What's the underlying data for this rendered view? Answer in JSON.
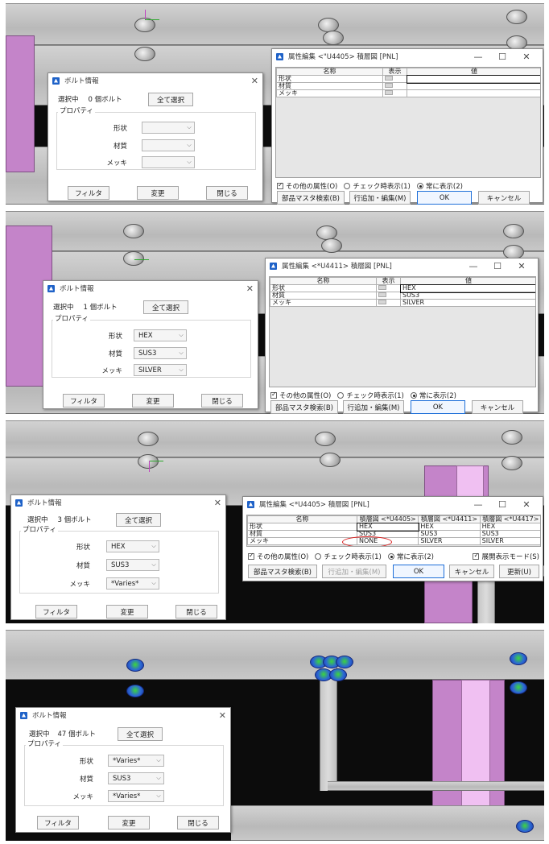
{
  "bolt_dialog": {
    "title": "ボルト情報",
    "select_all": "全て選択",
    "properties_group": "プロパティ",
    "shape_label": "形状",
    "material_label": "材質",
    "plating_label": "メッキ",
    "filter_button": "フィルタ",
    "change_button": "変更",
    "close_button": "閉じる"
  },
  "attr_dialog": {
    "col_name": "名称",
    "col_display": "表示",
    "col_value": "値",
    "rows": [
      "形状",
      "材質",
      "メッキ"
    ],
    "other_attrs": "その他の属性(O)",
    "radio_on_check": "チェック時表示(1)",
    "radio_always": "常に表示(2)",
    "parts_master": "部品マスタ検索(B)",
    "add_edit_rows": "行追加・編集(M)",
    "ok": "OK",
    "cancel": "キャンセル",
    "expand_mode": "展開表示モード(S)",
    "update": "更新(U)"
  },
  "panels": [
    {
      "bolt": {
        "selection": "選択中",
        "count": "0 個ボルト",
        "shape": "",
        "material": "",
        "plating": ""
      },
      "attr": {
        "title": "属性編集 <\"U4405> 積層図 [PNL]",
        "values": [
          "",
          "",
          ""
        ]
      }
    },
    {
      "bolt": {
        "selection": "選択中",
        "count": "1 個ボルト",
        "shape": "HEX",
        "material": "SUS3",
        "plating": "SILVER"
      },
      "attr": {
        "title": "属性編集 <*U4411> 積層図 [PNL]",
        "values": [
          "HEX",
          "SUS3",
          "SILVER"
        ]
      }
    },
    {
      "bolt": {
        "selection": "選択中",
        "count": "3 個ボルト",
        "shape": "HEX",
        "material": "SUS3",
        "plating": "*Varies*"
      },
      "attr": {
        "title": "属性編集 <*U4405> 積層図 [PNL]",
        "columns": [
          "積層図 <*U4405>",
          "積層図 <*U4411>",
          "積層図 <*U4417>"
        ],
        "matrix": [
          [
            "HEX",
            "HEX",
            "HEX"
          ],
          [
            "SUS3",
            "SUS3",
            "SUS3"
          ],
          [
            "NONE",
            "SILVER",
            "SILVER"
          ]
        ]
      }
    },
    {
      "bolt": {
        "selection": "選択中",
        "count": "47 個ボルト",
        "shape": "*Varies*",
        "material": "SUS3",
        "plating": "*Varies*"
      }
    }
  ],
  "colors": {
    "accent": "#1e6fd8",
    "highlight_ring": "#d81c1c",
    "cad_background": "#0c0c0c",
    "member_pink": "#c484c9"
  }
}
